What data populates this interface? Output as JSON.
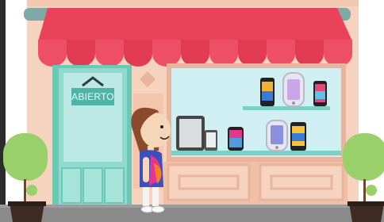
{
  "sign": {
    "text": "ABIERTO"
  },
  "colors": {
    "background": "#ffffff",
    "building": "#f6d3bf",
    "trim": "#e8b49c",
    "awning_red": "#e8435b",
    "awning_stripe": "#f26478",
    "awning_roll": "#7fa8a8",
    "door": "#8fdacc",
    "door_frame": "#6cc9b8",
    "window_glass": "#cfeff2",
    "shelf": "#7fcfc6",
    "sidewalk": "#8a8a8a",
    "bush": "#9ad06a",
    "pot": "#3e2b22"
  },
  "products": [
    "phone-icon",
    "phone-icon",
    "phone-icon",
    "tablet-icon",
    "phone-icon",
    "phone-icon",
    "phone-icon",
    "phone-icon",
    "phone-icon"
  ],
  "character": {
    "shirt_colors": [
      "#e6368c",
      "#3b4fbf",
      "#f37e2a"
    ]
  }
}
